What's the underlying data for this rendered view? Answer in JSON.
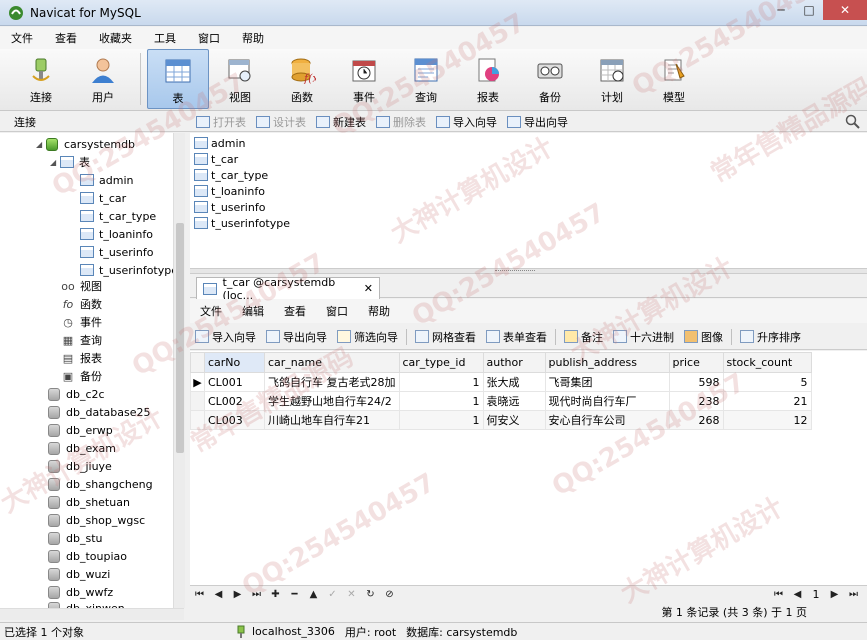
{
  "window": {
    "title": "Navicat for MySQL",
    "minimize": "─",
    "maximize": "□",
    "close": "✕"
  },
  "menu": [
    "文件",
    "查看",
    "收藏夹",
    "工具",
    "窗口",
    "帮助"
  ],
  "main_toolbar": [
    {
      "label": "连接",
      "icon": "plug-icon"
    },
    {
      "label": "用户",
      "icon": "user-icon"
    },
    {
      "label": "表",
      "icon": "table-icon",
      "active": true
    },
    {
      "label": "视图",
      "icon": "view-icon"
    },
    {
      "label": "函数",
      "icon": "function-icon"
    },
    {
      "label": "事件",
      "icon": "event-icon"
    },
    {
      "label": "查询",
      "icon": "query-icon"
    },
    {
      "label": "报表",
      "icon": "report-icon"
    },
    {
      "label": "备份",
      "icon": "backup-icon"
    },
    {
      "label": "计划",
      "icon": "schedule-icon"
    },
    {
      "label": "模型",
      "icon": "model-icon"
    }
  ],
  "connection_header": "连接",
  "object_toolbar": {
    "open": "打开表",
    "design": "设计表",
    "new": "新建表",
    "delete": "删除表",
    "import": "导入向导",
    "export": "导出向导"
  },
  "tree": {
    "db": "carsystemdb",
    "tables_label": "表",
    "tables": [
      "admin",
      "t_car",
      "t_car_type",
      "t_loaninfo",
      "t_userinfo",
      "t_userinfotype"
    ],
    "objects": [
      "视图",
      "函数",
      "事件",
      "查询",
      "报表",
      "备份"
    ],
    "object_glyphs": [
      "oo",
      "fo",
      "◷",
      "▦",
      "▤",
      "▣"
    ],
    "other_dbs": [
      "db_c2c",
      "db_database25",
      "db_erwp",
      "db_exam",
      "db_jiuye",
      "db_shangcheng",
      "db_shetuan",
      "db_shop_wgsc",
      "db_stu",
      "db_toupiao",
      "db_wuzi",
      "db_wwfz",
      "db_xinwen"
    ]
  },
  "object_list": [
    "admin",
    "t_car",
    "t_car_type",
    "t_loaninfo",
    "t_userinfo",
    "t_userinfotype"
  ],
  "tab": {
    "label": "t_car @carsystemdb (loc...",
    "close": "✕"
  },
  "table_menu": [
    "文件",
    "编辑",
    "查看",
    "窗口",
    "帮助"
  ],
  "table_toolbar": {
    "import": "导入向导",
    "export": "导出向导",
    "filter": "筛选向导",
    "grid": "网格查看",
    "form": "表单查看",
    "memo": "备注",
    "hex": "十六进制",
    "image": "图像",
    "sort": "升序排序"
  },
  "grid": {
    "columns": [
      "carNo",
      "car_name",
      "car_type_id",
      "author",
      "publish_address",
      "price",
      "stock_count"
    ],
    "rows": [
      [
        "CL001",
        "飞鸽自行车 复古老式28加",
        "1",
        "张大成",
        "飞哥集团",
        "598",
        "5"
      ],
      [
        "CL002",
        "学生越野山地自行车24/2",
        "1",
        "袁晓远",
        "现代时尚自行车厂",
        "238",
        "21"
      ],
      [
        "CL003",
        "川崎山地车自行车21",
        "1",
        "何安义",
        "安心自行车公司",
        "268",
        "12"
      ]
    ]
  },
  "nav": {
    "page": "1",
    "record_status": "第 1 条记录 (共 3 条) 于 1 页"
  },
  "status": {
    "selected": "已选择 1 个对象",
    "host": "localhost_3306",
    "user": "用户: root",
    "database": "数据库: carsystemdb"
  },
  "watermarks": [
    "QQ:254540457",
    "大神计算机设计",
    "常年售精品源码"
  ]
}
